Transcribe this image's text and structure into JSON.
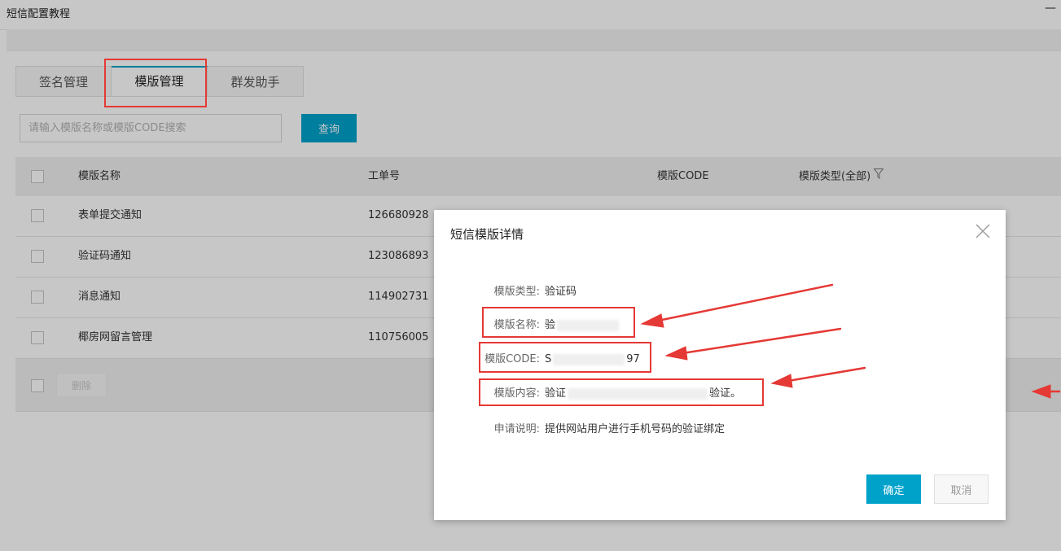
{
  "window": {
    "title": "短信配置教程",
    "minimize_label": "—"
  },
  "tabs": [
    {
      "label": "签名管理"
    },
    {
      "label": "模版管理"
    },
    {
      "label": "群发助手"
    }
  ],
  "search": {
    "placeholder": "请输入模版名称或模版CODE搜索",
    "button_label": "查询"
  },
  "table": {
    "headers": {
      "name": "模版名称",
      "order": "工单号",
      "code": "模版CODE",
      "type": "模版类型(全部)"
    },
    "rows": [
      {
        "name": "表单提交通知",
        "order": "126680928"
      },
      {
        "name": "验证码通知",
        "order": "123086893"
      },
      {
        "name": "消息通知",
        "order": "114902731"
      },
      {
        "name": "椰房网留言管理",
        "order": "110756005"
      }
    ],
    "delete_label": "删除"
  },
  "modal": {
    "title": "短信模版详情",
    "fields": {
      "type": {
        "label": "模版类型:",
        "value": "验证码"
      },
      "name": {
        "label": "模版名称:",
        "value": "验"
      },
      "code": {
        "label": "模版CODE:",
        "value_start": "S",
        "value_end": "97"
      },
      "content": {
        "label": "模版内容:",
        "value_start": "验证",
        "value_end": "验证。"
      },
      "desc": {
        "label": "申请说明:",
        "value": "提供网站用户进行手机号码的验证绑定"
      }
    },
    "ok_label": "确定",
    "cancel_label": "取消"
  },
  "colors": {
    "accent": "#00a2ca",
    "annotation": "#e53935",
    "overlay": "rgba(0,0,0,0.22)"
  },
  "icons": {
    "close": "close-icon",
    "filter": "filter-icon"
  }
}
